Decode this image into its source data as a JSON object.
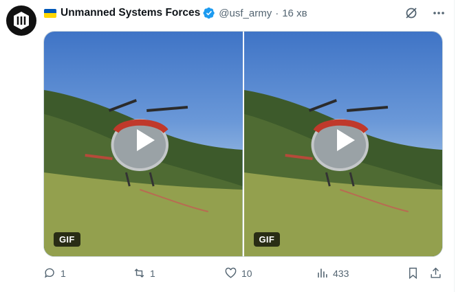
{
  "account": {
    "display_name": "Unmanned Systems Forces",
    "handle": "@usf_army",
    "separator": "·",
    "time": "16 хв"
  },
  "media": {
    "items": [
      {
        "badge": "GIF"
      },
      {
        "badge": "GIF"
      }
    ]
  },
  "actions": {
    "replies": "1",
    "reposts": "1",
    "likes": "10",
    "views": "433"
  },
  "icons": {
    "header": [
      "grok-icon",
      "more-icon"
    ],
    "actions": [
      "reply-icon",
      "repost-icon",
      "like-icon",
      "views-icon",
      "bookmark-icon",
      "share-icon"
    ]
  },
  "colors": {
    "verified": "#1d9bf0",
    "flag_blue": "#0057b7",
    "flag_yellow": "#ffd700",
    "muted_text": "#536471"
  }
}
